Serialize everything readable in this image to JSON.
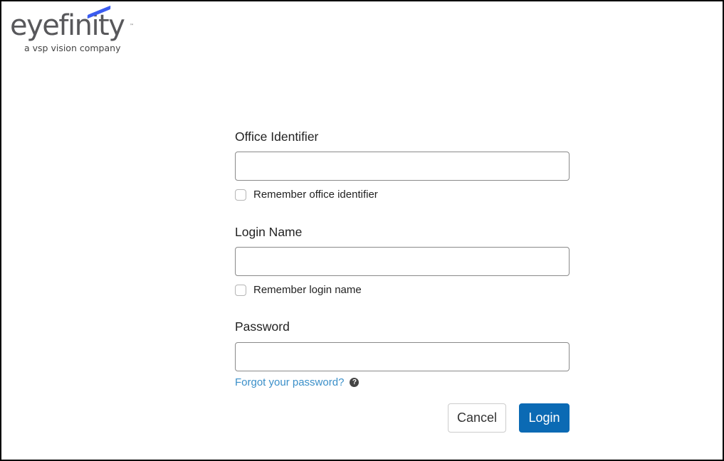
{
  "logo": {
    "wordmark": "eyefinity",
    "trademark": "™",
    "tagline": "a vsp vision company",
    "accent_color": "#3b5cf0"
  },
  "form": {
    "office_identifier": {
      "label": "Office Identifier",
      "value": "",
      "placeholder": "",
      "remember_label": "Remember office identifier",
      "remember_checked": false
    },
    "login_name": {
      "label": "Login Name",
      "value": "",
      "placeholder": "",
      "remember_label": "Remember login name",
      "remember_checked": false
    },
    "password": {
      "label": "Password",
      "value": "",
      "placeholder": ""
    },
    "forgot_password_link": "Forgot your password?",
    "help_icon": "?",
    "cancel_label": "Cancel",
    "login_label": "Login",
    "primary_color": "#0b6ab4",
    "link_color": "#3a8fc9"
  }
}
